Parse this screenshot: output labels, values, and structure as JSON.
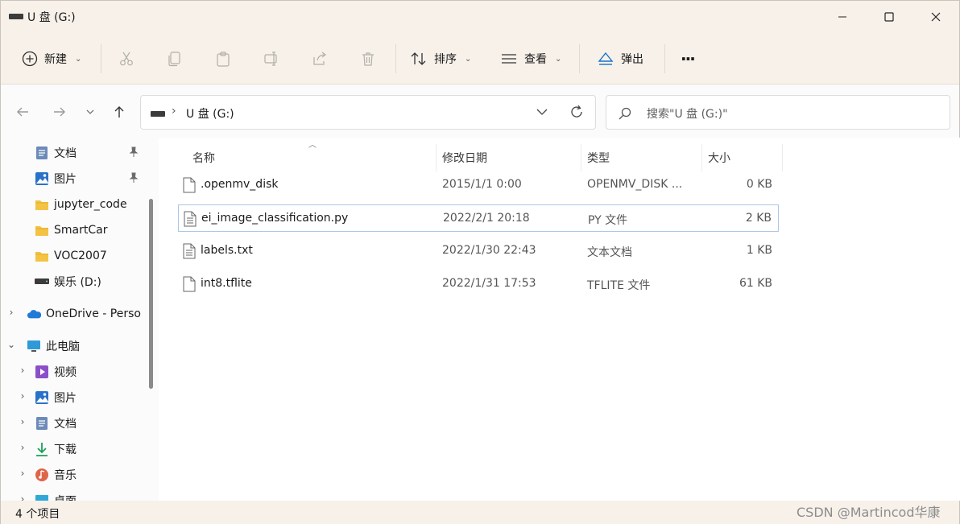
{
  "window": {
    "title": "U 盘 (G:)"
  },
  "toolbar": {
    "new_label": "新建",
    "sort_label": "排序",
    "view_label": "查看",
    "eject_label": "弹出",
    "more_label": "···"
  },
  "address": {
    "separator": "›",
    "path": "U 盘 (G:)"
  },
  "search": {
    "placeholder": "搜索\"U 盘 (G:)\""
  },
  "sidebar": {
    "items": [
      {
        "label": "文档",
        "icon": "documents-icon",
        "pinned": true
      },
      {
        "label": "图片",
        "icon": "pictures-icon",
        "pinned": true
      },
      {
        "label": "jupyter_code",
        "icon": "folder-icon"
      },
      {
        "label": "SmartCar",
        "icon": "folder-icon"
      },
      {
        "label": "VOC2007",
        "icon": "folder-icon"
      },
      {
        "label": "娱乐 (D:)",
        "icon": "drive-icon"
      },
      {
        "label": "OneDrive - Perso",
        "icon": "onedrive-icon",
        "expand": "›"
      },
      {
        "label": "此电脑",
        "icon": "computer-icon",
        "expand": "⌄"
      },
      {
        "label": "视频",
        "icon": "videos-icon",
        "expand": "›"
      },
      {
        "label": "图片",
        "icon": "pictures-icon",
        "expand": "›"
      },
      {
        "label": "文档",
        "icon": "documents-icon",
        "expand": "›"
      },
      {
        "label": "下载",
        "icon": "downloads-icon",
        "expand": "›"
      },
      {
        "label": "音乐",
        "icon": "music-icon",
        "expand": "›"
      },
      {
        "label": "桌面",
        "icon": "desktop-icon",
        "expand": "›"
      }
    ]
  },
  "columns": {
    "name": "名称",
    "date": "修改日期",
    "type": "类型",
    "size": "大小"
  },
  "files": [
    {
      "name": ".openmv_disk",
      "date": "2015/1/1 0:00",
      "type": "OPENMV_DISK ...",
      "size": "0 KB"
    },
    {
      "name": "ei_image_classification.py",
      "date": "2022/2/1 20:18",
      "type": "PY 文件",
      "size": "2 KB",
      "selected": true
    },
    {
      "name": "labels.txt",
      "date": "2022/1/30 22:43",
      "type": "文本文档",
      "size": "1 KB"
    },
    {
      "name": "int8.tflite",
      "date": "2022/1/31 17:53",
      "type": "TFLITE 文件",
      "size": "61 KB"
    }
  ],
  "status": {
    "count": "4 个项目",
    "watermark": "CSDN @Martincod华康"
  },
  "colors": {
    "accent": "#0067c0",
    "chrome": "#f7f1ea",
    "selection_border": "#a9c9e6"
  }
}
